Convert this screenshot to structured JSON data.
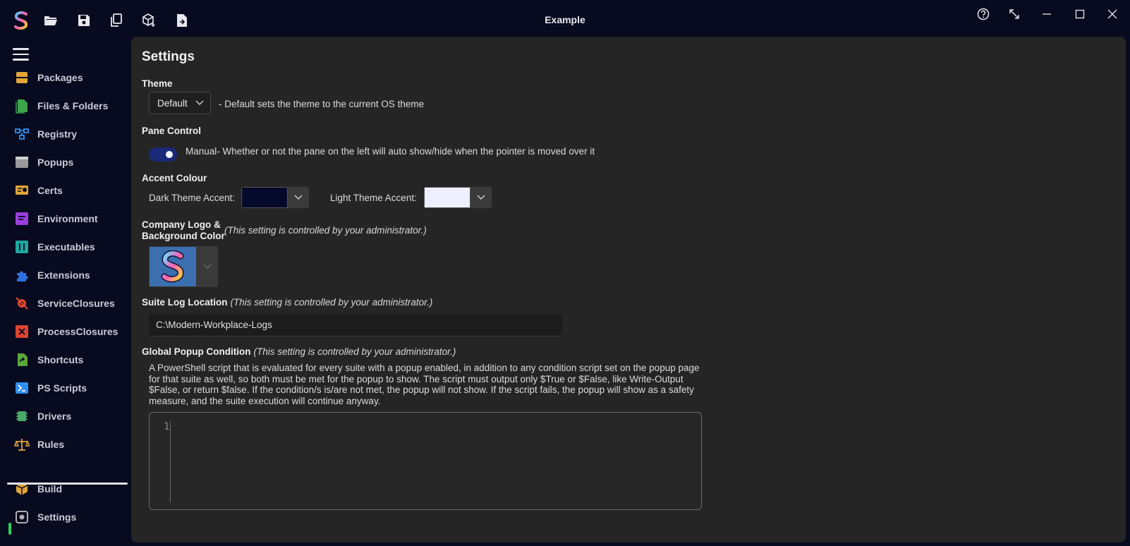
{
  "window": {
    "title": "Example"
  },
  "toolbar": {
    "icons": [
      "app-logo-icon",
      "folder-open-icon",
      "save-icon",
      "copy-icon",
      "new-package-icon",
      "export-file-icon"
    ]
  },
  "window_controls": {
    "icons": [
      "help-icon",
      "expand-icon",
      "minimize-icon",
      "maximize-icon",
      "close-icon"
    ]
  },
  "sidebar": {
    "items": [
      {
        "label": "Packages",
        "icon": "packages-icon",
        "color": "#e2a53a"
      },
      {
        "label": "Files & Folders",
        "icon": "files-icon",
        "color": "#3fa34d"
      },
      {
        "label": "Registry",
        "icon": "registry-icon",
        "color": "#2f8ff0"
      },
      {
        "label": "Popups",
        "icon": "popups-icon",
        "color": "#9a9a9a"
      },
      {
        "label": "Certs",
        "icon": "certs-icon",
        "color": "#e2a53a"
      },
      {
        "label": "Environment",
        "icon": "environment-icon",
        "color": "#9b3de0"
      },
      {
        "label": "Executables",
        "icon": "executables-icon",
        "color": "#1fa7a0"
      },
      {
        "label": "Extensions",
        "icon": "extensions-icon",
        "color": "#2f6fe0"
      },
      {
        "label": "ServiceClosures",
        "icon": "service-closures-icon",
        "color": "#e0442f"
      },
      {
        "label": "ProcessClosures",
        "icon": "process-closures-icon",
        "color": "#e0442f"
      },
      {
        "label": "Shortcuts",
        "icon": "shortcuts-icon",
        "color": "#5aa83a"
      },
      {
        "label": "PS Scripts",
        "icon": "ps-scripts-icon",
        "color": "#2f8ff0"
      },
      {
        "label": "Drivers",
        "icon": "drivers-icon",
        "color": "#4aa86a"
      },
      {
        "label": "Rules",
        "icon": "rules-icon",
        "color": "#e2a53a"
      }
    ],
    "bottom": [
      {
        "label": "Build",
        "icon": "build-icon",
        "color": "#e2a53a"
      },
      {
        "label": "Settings",
        "icon": "settings-icon",
        "color": "#b0b0b0",
        "active": true
      }
    ]
  },
  "settings": {
    "title": "Settings",
    "theme": {
      "label": "Theme",
      "value": "Default",
      "description": "- Default sets the theme to the current OS theme"
    },
    "pane_control": {
      "label": "Pane Control",
      "toggle_on": true,
      "description": "Manual- Whether or not the pane on the left will auto show/hide when the pointer is moved over it"
    },
    "accent": {
      "label": "Accent Colour",
      "dark_label": "Dark Theme Accent:",
      "dark_color": "#050a2a",
      "light_label": "Light Theme Accent:",
      "light_color": "#eef0ff"
    },
    "company_logo": {
      "label_line1": "Company Logo &",
      "label_line2": "Background Color",
      "note": "(This setting is controlled by your administrator.)"
    },
    "suite_log": {
      "label": "Suite Log Location",
      "note": "(This setting is controlled by your administrator.)",
      "value": "C:\\Modern-Workplace-Logs"
    },
    "global_popup": {
      "label": "Global Popup Condition",
      "note": "(This setting is controlled by your administrator.)",
      "description": "A PowerShell script that is evaluated for every suite with a popup enabled, in addition to any condition script set on the popup page for that suite as well, so both must be met for the popup to show. The script must output only $True or $False, like Write-Output $False, or return $false. If the condition/s is/are not met, the popup will not show. If the script fails, the popup will show as a safety measure, and the suite execution will continue anyway.",
      "line_number": "1"
    }
  }
}
